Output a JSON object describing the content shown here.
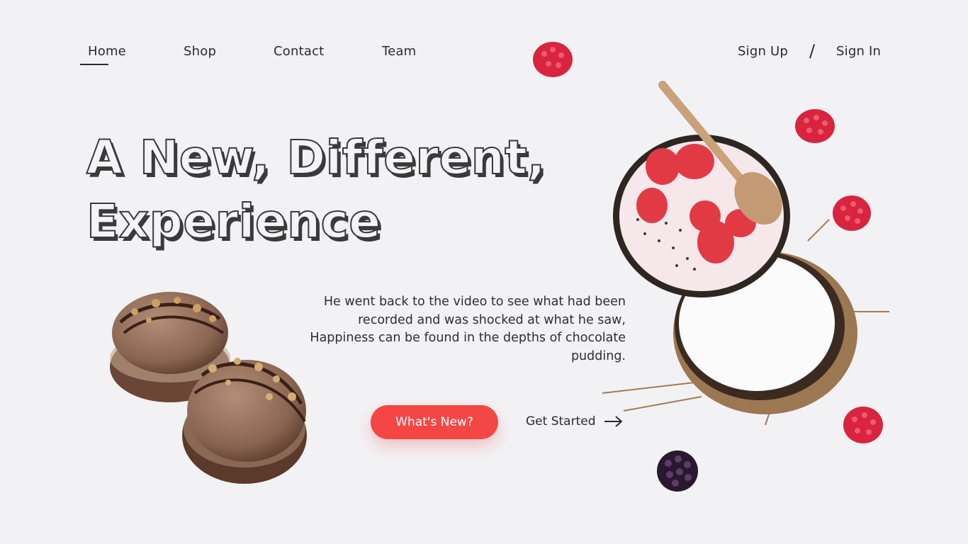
{
  "nav": {
    "items": [
      {
        "label": "Home",
        "active": true
      },
      {
        "label": "Shop"
      },
      {
        "label": "Contact"
      },
      {
        "label": "Team"
      }
    ],
    "auth": {
      "sign_up": "Sign Up",
      "separator": "/",
      "sign_in": "Sign In"
    }
  },
  "hero": {
    "title_line1": "A New, Different,",
    "title_line2": "Experience",
    "description": "He went back to the video to see what had been recorded and was shocked at what he saw, Happiness can be found in the depths of chocolate pudding.",
    "primary_button": "What's New?",
    "secondary_link": "Get Started"
  },
  "colors": {
    "accent": "#f54646",
    "background": "#f2f2f4",
    "text": "#2b2b2b"
  },
  "icons": {
    "arrow": "arrow-right-icon"
  }
}
